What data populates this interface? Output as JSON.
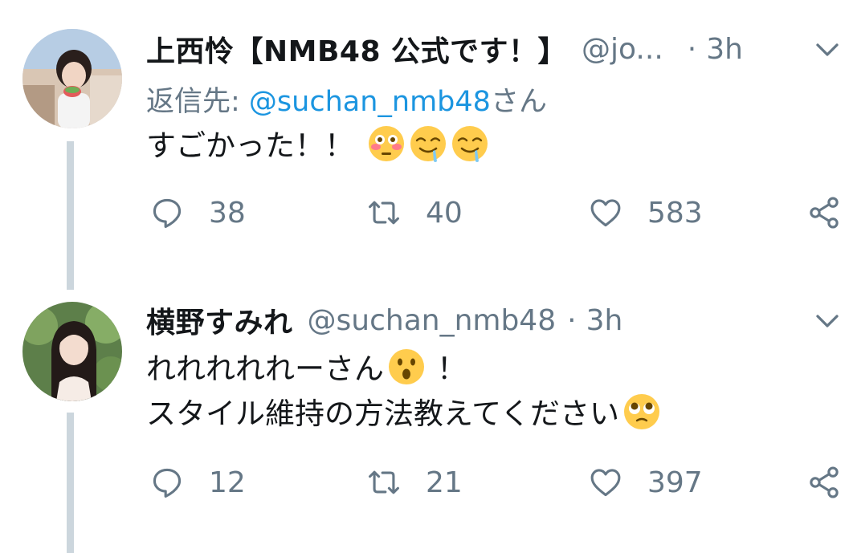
{
  "tweets": [
    {
      "display_name": "上西怜【NMB48 公式です！】",
      "handle": "@jo...",
      "dot": "·",
      "time": "3h",
      "reply_prefix": "返信先: ",
      "reply_mention": "@suchan_nmb48",
      "reply_suffix": "さん",
      "text_line1": "すごかった！！",
      "text_line2": "",
      "counts": {
        "reply": "38",
        "retweet": "40",
        "like": "583"
      }
    },
    {
      "display_name": "横野すみれ",
      "handle": "@suchan_nmb48",
      "dot": "·",
      "time": "3h",
      "text_line1": "れれれれれーさん",
      "text_line1_after": "！",
      "text_line2": "スタイル維持の方法教えてください",
      "counts": {
        "reply": "12",
        "retweet": "21",
        "like": "397"
      }
    }
  ],
  "icons": {
    "caret": "chevron-down-icon",
    "reply": "reply-bubble-icon",
    "retweet": "retweet-icon",
    "like": "heart-icon",
    "share": "share-icon",
    "emoji_flushed": "flushed-face-emoji",
    "emoji_drooling": "drooling-face-emoji",
    "emoji_hushed": "hushed-face-emoji",
    "emoji_pleading": "pleading-face-emoji"
  },
  "colors": {
    "text": "#14171a",
    "secondary": "#657786",
    "link": "#1b95e0",
    "thread_line": "#ccd6dd",
    "emoji_yellow": "#ffcc4d"
  }
}
